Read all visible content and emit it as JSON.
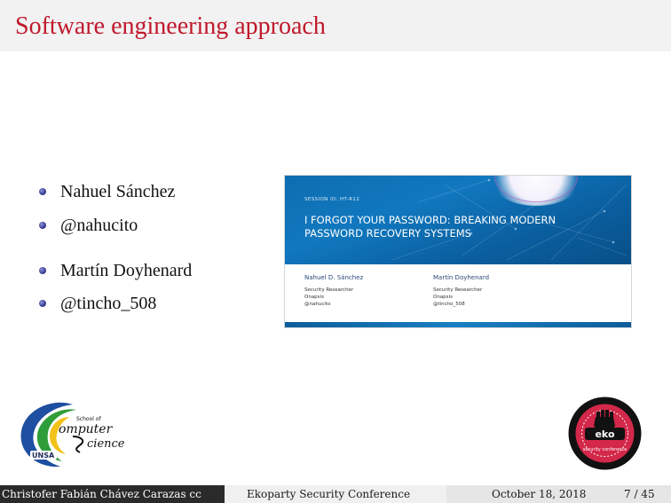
{
  "slide": {
    "title": "Software engineering approach",
    "bullets": [
      {
        "text": "Nahuel Sánchez"
      },
      {
        "text": "@nahucito"
      },
      {
        "text": "Martín Doyhenard"
      },
      {
        "text": "@tincho_508"
      }
    ]
  },
  "paper_thumbnail": {
    "session": "SESSION ID: HT-R12",
    "heading": "I FORGOT YOUR PASSWORD: BREAKING MODERN PASSWORD RECOVERY SYSTEMS",
    "authors": [
      {
        "name": "Nahuel D. Sánchez",
        "role": "Security Researcher",
        "org": "Onapsis",
        "handle": "@nahucito"
      },
      {
        "name": "Martín Doyhenard",
        "role": "Security Researcher",
        "org": "Onapsis",
        "handle": "@tincho_508"
      }
    ],
    "colors": {
      "banner": "#1178bf"
    }
  },
  "logos": {
    "left": {
      "name": "school-of-computer-science-logo",
      "text_school": "School of",
      "text_computer": "omputer",
      "text_science": "cience",
      "text_unsa": "UNSA"
    },
    "right": {
      "name": "ekoparty-logo",
      "text_main": "ekoparty",
      "text_ring": "security conference"
    }
  },
  "footer": {
    "author": "Christofer Fabián Chávez Carazas  cc",
    "event": "Ekoparty Security Conference",
    "date": "October 18, 2018",
    "page": "7 / 45"
  },
  "colors": {
    "title": "#c0182b",
    "footer_dark": "#2a2a2a"
  }
}
